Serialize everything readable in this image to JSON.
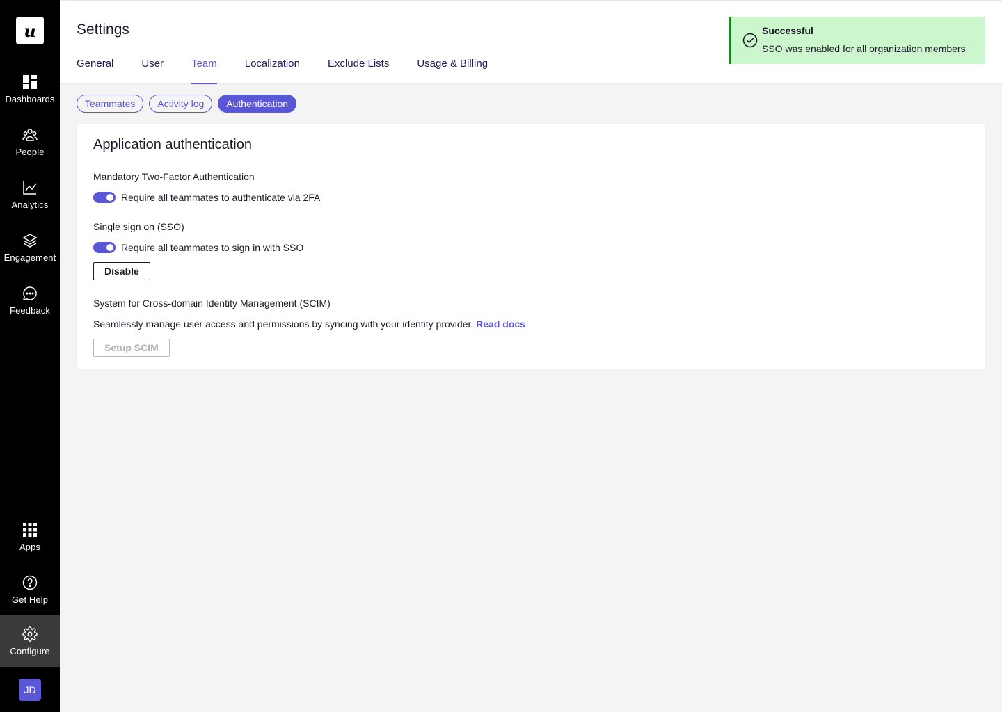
{
  "brand": {
    "logo_text": "u",
    "accent": "#5a57d6"
  },
  "sidebar": {
    "items": [
      {
        "label": "Dashboards",
        "icon": "dashboard-icon"
      },
      {
        "label": "People",
        "icon": "people-icon"
      },
      {
        "label": "Analytics",
        "icon": "analytics-icon"
      },
      {
        "label": "Engagement",
        "icon": "layers-icon"
      },
      {
        "label": "Feedback",
        "icon": "chat-icon"
      },
      {
        "label": "Apps",
        "icon": "apps-grid-icon"
      },
      {
        "label": "Get Help",
        "icon": "help-icon"
      },
      {
        "label": "Configure",
        "icon": "gear-icon",
        "active": true
      }
    ],
    "avatar_initials": "JD"
  },
  "header": {
    "title": "Settings",
    "tabs": [
      {
        "label": "General"
      },
      {
        "label": "User"
      },
      {
        "label": "Team",
        "active": true
      },
      {
        "label": "Localization"
      },
      {
        "label": "Exclude Lists"
      },
      {
        "label": "Usage & Billing"
      }
    ]
  },
  "toast": {
    "title": "Successful",
    "message": "SSO was enabled for all organization members",
    "icon": "check-circle-icon",
    "color": "#178a1d"
  },
  "subtabs": [
    {
      "label": "Teammates"
    },
    {
      "label": "Activity log"
    },
    {
      "label": "Authentication",
      "active": true
    }
  ],
  "card": {
    "title": "Application authentication",
    "twofa": {
      "title": "Mandatory Two-Factor Authentication",
      "toggle_label": "Require all teammates to authenticate via 2FA",
      "enabled": true
    },
    "sso": {
      "title": "Single sign on (SSO)",
      "toggle_label": "Require all teammates to sign in with SSO",
      "enabled": true,
      "disable_label": "Disable"
    },
    "scim": {
      "title": "System for Cross-domain Identity Management (SCIM)",
      "description": "Seamlessly manage user access and permissions by syncing with your identity provider.",
      "link": "Read docs",
      "setup_label": "Setup SCIM"
    }
  }
}
